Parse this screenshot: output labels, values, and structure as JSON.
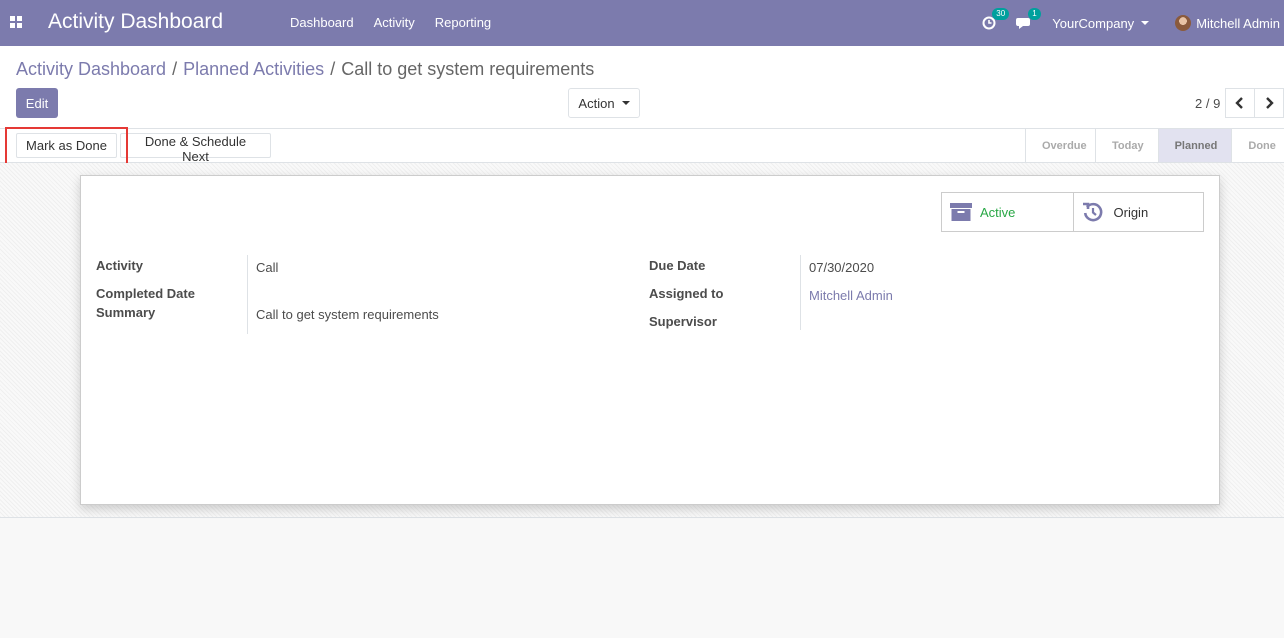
{
  "navbar": {
    "brand": "Activity Dashboard",
    "menu": [
      "Dashboard",
      "Activity",
      "Reporting"
    ],
    "activity_count": "30",
    "message_count": "1",
    "company": "YourCompany",
    "user": "Mitchell Admin",
    "color": "#7c7bad"
  },
  "breadcrumb": [
    "Activity Dashboard",
    "Planned Activities",
    "Call to get system requirements"
  ],
  "controls": {
    "edit_label": "Edit",
    "action_label": "Action",
    "pager": "2 / 9"
  },
  "statusbar": {
    "mark_done_label": "Mark as Done",
    "done_schedule_label": "Done & Schedule Next",
    "stages": [
      "Overdue",
      "Today",
      "Planned",
      "Done"
    ],
    "active_stage": "Planned"
  },
  "smart_buttons": {
    "active_label": "Active",
    "origin_label": "Origin"
  },
  "form": {
    "activity_label": "Activity",
    "activity_value": "Call",
    "completed_date_label": "Completed Date",
    "summary_label": "Summary",
    "summary_value": "Call to get system requirements",
    "due_date_label": "Due Date",
    "due_date_value": "07/30/2020",
    "assigned_to_label": "Assigned to",
    "assigned_to_value": "Mitchell Admin",
    "supervisor_label": "Supervisor"
  },
  "colors": {
    "accent": "#7c7bad",
    "active_green": "#28a745",
    "badge": "#00a09d",
    "highlight": "#e53935"
  }
}
